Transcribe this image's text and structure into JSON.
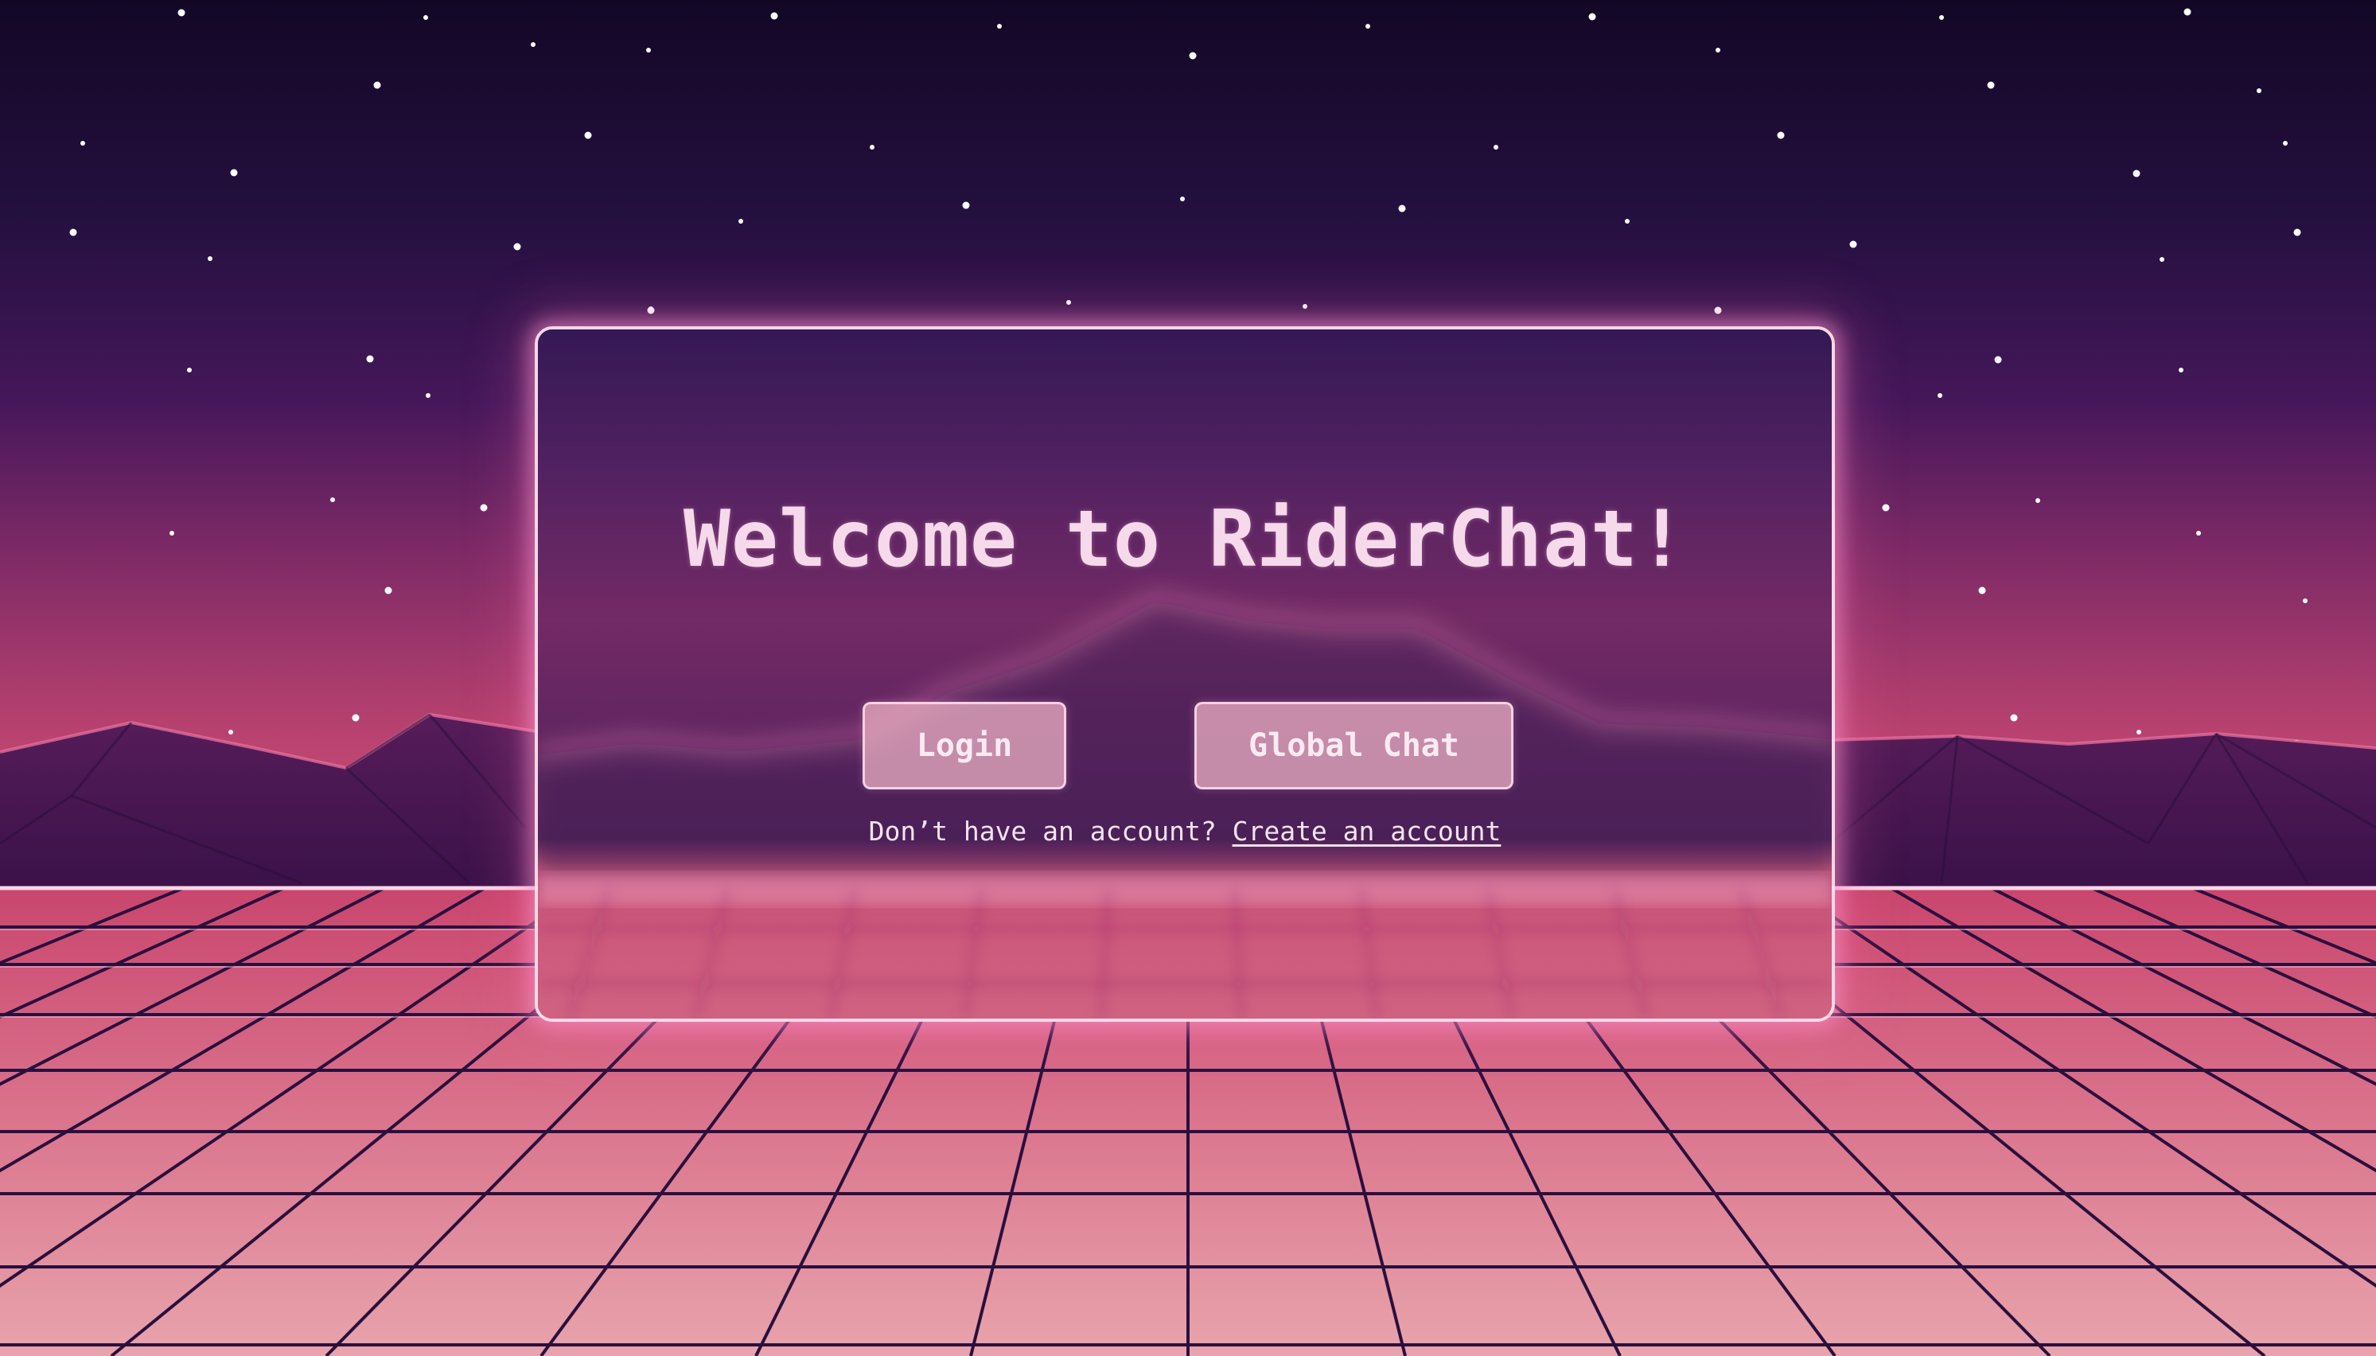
{
  "page": {
    "title": "Welcome to RiderChat!"
  },
  "actions": {
    "login_label": "Login",
    "global_chat_label": "Global Chat"
  },
  "signup": {
    "prompt": "Don’t have an account? ",
    "link_label": "Create an account"
  },
  "theme": {
    "sky_top": "#130726",
    "sky_mid": "#3a1450",
    "horizon": "#b8426f",
    "grid_floor_top": "#c9456d",
    "grid_floor_bottom": "#e8a2aa",
    "grid_line": "#2a0f3d",
    "text": "#f6d9ea",
    "button_fill": "#e2a8bb"
  }
}
